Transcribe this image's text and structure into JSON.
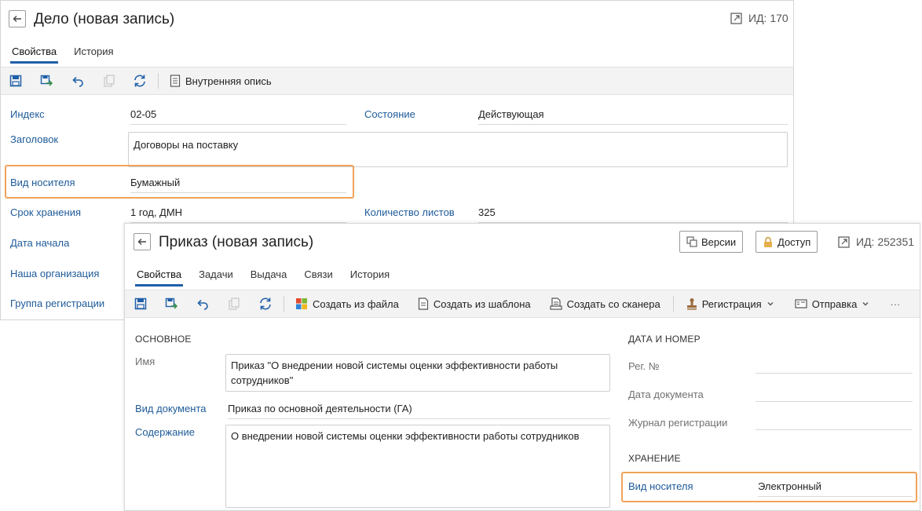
{
  "case": {
    "title": "Дело (новая запись)",
    "id_label": "ИД: 170",
    "tabs": [
      "Свойства",
      "История"
    ],
    "toolbar": {
      "inventory_label": "Внутренняя опись"
    },
    "fields": {
      "index_label": "Индекс",
      "index_value": "02-05",
      "state_label": "Состояние",
      "state_value": "Действующая",
      "heading_label": "Заголовок",
      "heading_value": "Договоры на поставку",
      "medium_label": "Вид носителя",
      "medium_value": "Бумажный",
      "storage_label": "Срок хранения",
      "storage_value": "1 год, ДМН",
      "sheets_label": "Количество листов",
      "sheets_value": "325",
      "start_label": "Дата начала",
      "org_label": "Наша организация",
      "group_label": "Группа регистрации"
    }
  },
  "order": {
    "title": "Приказ (новая запись)",
    "versions_label": "Версии",
    "access_label": "Доступ",
    "id_label": "ИД: 252351",
    "tabs": [
      "Свойства",
      "Задачи",
      "Выдача",
      "Связи",
      "История"
    ],
    "toolbar": {
      "from_file": "Создать из файла",
      "from_template": "Создать из шаблона",
      "from_scanner": "Создать со сканера",
      "registration": "Регистрация",
      "sending": "Отправка",
      "more": "···"
    },
    "main_section": "ОСНОВНОЕ",
    "date_section": "ДАТА И НОМЕР",
    "storage_section": "ХРАНЕНИЕ",
    "fields": {
      "name_label": "Имя",
      "name_value": "Приказ \"О внедрении новой системы оценки эффективности работы сотрудников\"",
      "doc_type_label": "Вид документа",
      "doc_type_value": "Приказ по основной деятельности (ГА)",
      "content_label": "Содержание",
      "content_value": "О внедрении новой системы оценки эффективности работы сотрудников",
      "reg_no_label": "Рег. №",
      "doc_date_label": "Дата документа",
      "journal_label": "Журнал регистрации",
      "medium_label": "Вид носителя",
      "medium_value": "Электронный"
    }
  },
  "colors": {
    "accent": "#1f5fa8",
    "highlight": "#f0a35a",
    "label": "#1e5b99"
  }
}
